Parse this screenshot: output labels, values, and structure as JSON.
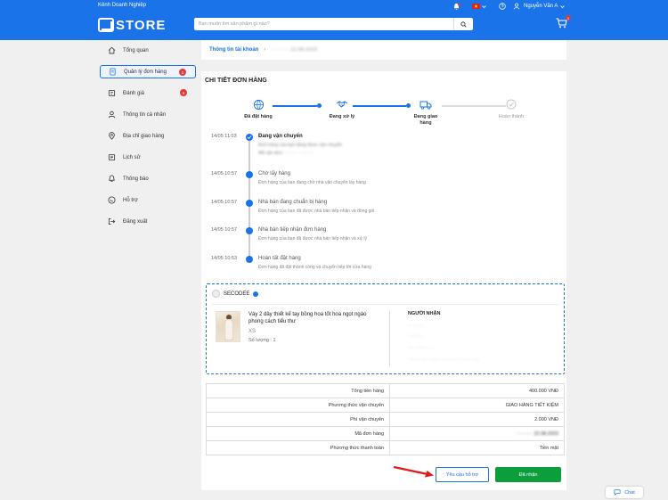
{
  "header": {
    "business_channel": "Kênh Doanh Nghiệp",
    "language_flag": "vn-flag",
    "user_name": "Nguyễn Văn A",
    "brand": "STORE",
    "search_placeholder": "Bạn muốn tìm sản phẩm gì nào?",
    "cart_count": "1"
  },
  "sidebar": {
    "items": [
      {
        "label": "Tổng quan",
        "icon": "home-icon"
      },
      {
        "label": "Quản lý đơn hàng",
        "icon": "order-icon",
        "badge": "2"
      },
      {
        "label": "Đánh giá",
        "icon": "review-icon",
        "badge": "6"
      },
      {
        "label": "Thông tin cá nhân",
        "icon": "user-icon"
      },
      {
        "label": "Địa chỉ giao hàng",
        "icon": "location-icon"
      },
      {
        "label": "Lịch sử",
        "icon": "history-icon"
      },
      {
        "label": "Thông báo",
        "icon": "bell-icon"
      },
      {
        "label": "Hỗ trợ",
        "icon": "support-icon"
      },
      {
        "label": "Đăng xuất",
        "icon": "logout-icon"
      }
    ]
  },
  "breadcrumb": {
    "root": "Thông tin tài khoản",
    "current": "·········· 22.08.2023"
  },
  "order": {
    "title": "CHI TIẾT ĐƠN HÀNG",
    "steps": [
      {
        "label": "Đã đặt hàng",
        "state": "done"
      },
      {
        "label": "Đang xử lý",
        "state": "done"
      },
      {
        "label": "Đang giao hàng",
        "state": "done"
      },
      {
        "label": "Hoàn thành",
        "state": "todo"
      }
    ],
    "timeline": [
      {
        "time": "14/05 11:03",
        "title": "Đang vận chuyển",
        "desc": "Đơn hàng của bạn đang được vận chuyển",
        "desc2": "Mã vận đơn: ········ · ·········",
        "current": true
      },
      {
        "time": "14/05 10:57",
        "title": "Chờ lấy hàng",
        "desc": "Đơn hàng của bạn đang chờ nhà vận chuyển lấy hàng"
      },
      {
        "time": "14/05 10:57",
        "title": "Nhà bán đang chuẩn bị hàng",
        "desc": "Đơn hàng của bạn đã được nhà bán tiếp nhận và đóng gói"
      },
      {
        "time": "14/05 10:57",
        "title": "Nhà bán tiếp nhận đơn hàng",
        "desc": "Đơn hàng của bạn đã được nhà bán tiếp nhận và xử lý"
      },
      {
        "time": "14/05 10:53",
        "title": "Hoàn tất đặt hàng",
        "desc": "Đơn hàng đã đặt thành công và chuyển tiếp tới cửa hàng"
      }
    ],
    "shop_name": "SECODEE",
    "product": {
      "name": "Váy 2 dây thiết kế tay bồng hoa tốt hoa ngọt ngào phong cách tiểu thư",
      "variant": "XS",
      "quantity": "Số lượng : 1"
    },
    "receiver": {
      "heading": "NGƯỜI NHẬN",
      "name": "··· ······",
      "phone": "··········",
      "address1": "···· ········ ·· ·",
      "address2": "········ ···· ········ ·········· ·· ·· ··· ·····"
    },
    "summary": [
      {
        "label": "Tổng tiền hàng",
        "value": "400.000 VNĐ"
      },
      {
        "label": "Phương thức vận chuyển",
        "value": "GIAO HÀNG TIẾT KIỆM"
      },
      {
        "label": "Phí vận chuyển",
        "value": "2.000 VNĐ"
      },
      {
        "label": "Mã đơn hàng",
        "value": "·········· 22.08.2023"
      },
      {
        "label": "Phương thức thanh toán",
        "value": "Tiền mặt"
      }
    ],
    "help_button": "Yêu cầu hỗ trợ",
    "received_button": "Đã nhận"
  },
  "chat_label": "Chat",
  "colors": {
    "primary": "#1a73e8",
    "success": "#0c9e3a",
    "badge": "#e53935"
  }
}
